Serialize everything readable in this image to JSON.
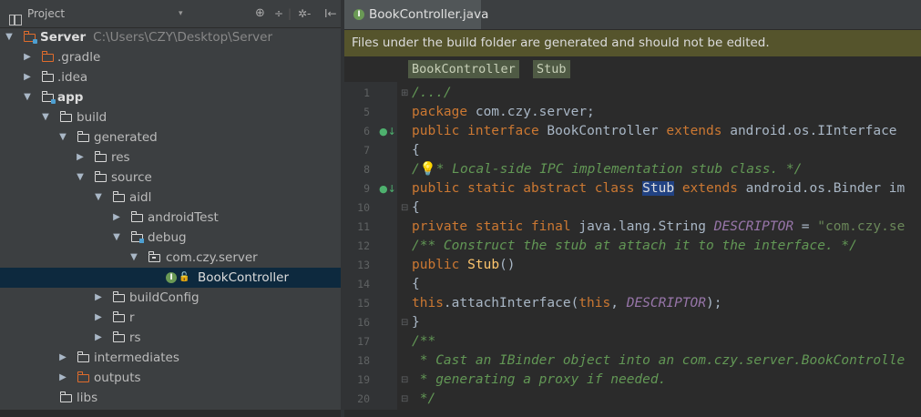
{
  "project_panel": {
    "title": "Project",
    "dropdown": "▾",
    "tools": {
      "globe": "⊕",
      "collapse": "÷",
      "sep": "|",
      "gear": "✲-",
      "hide": "I←"
    },
    "tree": [
      {
        "label": "Server",
        "hint": "C:\\Users\\CZY\\Desktop\\Server",
        "expanded": true
      },
      {
        "label": ".gradle",
        "expanded": false
      },
      {
        "label": ".idea",
        "expanded": false
      },
      {
        "label": "app",
        "expanded": true
      },
      {
        "label": "build",
        "expanded": true
      },
      {
        "label": "generated",
        "expanded": true
      },
      {
        "label": "res",
        "expanded": false
      },
      {
        "label": "source",
        "expanded": true
      },
      {
        "label": "aidl",
        "expanded": true
      },
      {
        "label": "androidTest",
        "expanded": false
      },
      {
        "label": "debug",
        "expanded": true
      },
      {
        "label": "com.czy.server",
        "expanded": true
      },
      {
        "label": "BookController",
        "selected": true
      },
      {
        "label": "buildConfig",
        "expanded": false
      },
      {
        "label": "r",
        "expanded": false
      },
      {
        "label": "rs",
        "expanded": false
      },
      {
        "label": "intermediates",
        "expanded": false
      },
      {
        "label": "outputs",
        "expanded": false
      },
      {
        "label": "libs"
      }
    ]
  },
  "editor": {
    "tab": {
      "label": "BookController.java",
      "close": "×",
      "icon_letter": "I"
    },
    "banner": "Files under the build folder are generated and should not be edited.",
    "breadcrumbs": [
      "BookController",
      "Stub"
    ],
    "line_numbers": [
      "1",
      "5",
      "6",
      "7",
      "8",
      "9",
      "10",
      "11",
      "12",
      "13",
      "14",
      "15",
      "16",
      "17",
      "18",
      "19",
      "20"
    ],
    "code": {
      "l1": "/.../",
      "l5_kw": "package",
      "l5_rest": " com.czy.server;",
      "l6_kw1": "public interface",
      "l6_name": " BookController ",
      "l6_kw2": "extends",
      "l6_rest": " android.os.IInterface",
      "l7": "{",
      "l8_a": "/",
      "l8_bulb": "💡",
      "l8_b": "* Local-side IPC implementation stub class. */",
      "l9_kw1": "public static abstract class",
      "l9_sp": " ",
      "l9_stub": "Stub",
      "l9_sp2": " ",
      "l9_kw2": "extends",
      "l9_rest": " android.os.Binder im",
      "l10": "{",
      "l11_kw": "private static final",
      "l11_type": " java.lang.String ",
      "l11_fld": "DESCRIPTOR",
      "l11_eq": " = ",
      "l11_str": "\"com.czy.se",
      "l12": "/** Construct the stub at attach it to the interface. */",
      "l13_kw": "public",
      "l13_sp": " ",
      "l13_fn": "Stub",
      "l13_rest": "()",
      "l14": "{",
      "l15_kw": "this",
      "l15_a": ".attachInterface(",
      "l15_kw2": "this",
      "l15_b": ", ",
      "l15_fld": "DESCRIPTOR",
      "l15_c": ");",
      "l16": "}",
      "l17": "/**",
      "l18": " * Cast an IBinder object into an com.czy.server.BookControlle",
      "l19": " * generating a proxy if needed.",
      "l20": " */"
    }
  }
}
